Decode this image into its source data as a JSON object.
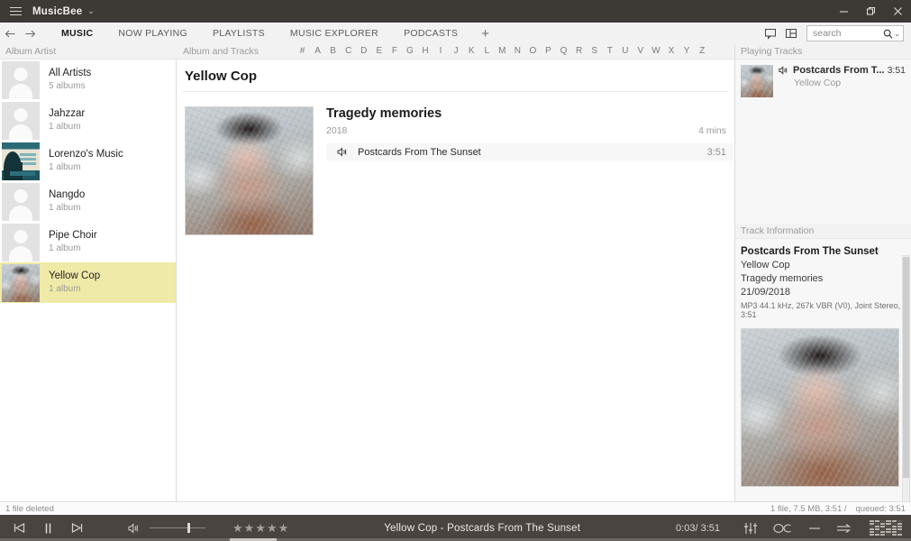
{
  "window": {
    "app_title": "MusicBee",
    "title_caret": "⌄",
    "minimize_label": "minimize",
    "maximize_label": "restore",
    "close_label": "close"
  },
  "toolbar": {
    "back_label": "back",
    "forward_label": "forward",
    "tabs": [
      {
        "label": "MUSIC",
        "active": true
      },
      {
        "label": "NOW PLAYING",
        "active": false
      },
      {
        "label": "PLAYLISTS",
        "active": false
      },
      {
        "label": "MUSIC EXPLORER",
        "active": false
      },
      {
        "label": "PODCASTS",
        "active": false
      }
    ],
    "add_tab_label": "+",
    "search": {
      "placeholder": "search",
      "value": ""
    }
  },
  "column_headers": {
    "left": "Album Artist",
    "middle": "Album and Tracks",
    "right": "Playing Tracks",
    "alphabet": [
      "#",
      "A",
      "B",
      "C",
      "D",
      "E",
      "F",
      "G",
      "H",
      "I",
      "J",
      "K",
      "L",
      "M",
      "N",
      "O",
      "P",
      "Q",
      "R",
      "S",
      "T",
      "U",
      "V",
      "W",
      "X",
      "Y",
      "Z"
    ]
  },
  "sidebar": {
    "items": [
      {
        "name": "All Artists",
        "sub": "5 albums",
        "selected": false,
        "art": "person"
      },
      {
        "name": "Jahzzar",
        "sub": "1 album",
        "selected": false,
        "art": "person"
      },
      {
        "name": "Lorenzo's Music",
        "sub": "1 album",
        "selected": false,
        "art": "lorenzo"
      },
      {
        "name": "Nangdo",
        "sub": "1 album",
        "selected": false,
        "art": "person"
      },
      {
        "name": "Pipe Choir",
        "sub": "1 album",
        "selected": false,
        "art": "person"
      },
      {
        "name": "Yellow Cop",
        "sub": "1 album",
        "selected": true,
        "art": "photo"
      }
    ]
  },
  "main": {
    "page_title": "Yellow Cop",
    "album": {
      "name": "Tragedy memories",
      "year": "2018",
      "length": "4 mins",
      "tracks": [
        {
          "playing_icon": "speaker-icon",
          "title": "Postcards From The Sunset",
          "duration": "3:51"
        }
      ]
    }
  },
  "right_panel": {
    "playing_tracks_header": "Playing Tracks",
    "playing": [
      {
        "title": "Postcards From T...",
        "artist": "Yellow Cop",
        "duration": "3:51"
      }
    ],
    "track_info_header": "Track Information",
    "track_info": {
      "title": "Postcards From The Sunset",
      "artist": "Yellow Cop",
      "album": "Tragedy memories",
      "date": "21/09/2018",
      "codec": "MP3 44.1 kHz, 267k VBR (V0), Joint Stereo, 3:51"
    }
  },
  "status_bar": {
    "left": "1 file deleted",
    "right": "1 file, 7.5 MB, 3:51 /",
    "queued": "queued: 3:51"
  },
  "player": {
    "previous_label": "previous",
    "play_pause_label": "pause",
    "next_label": "next",
    "volume_label": "volume",
    "rating_stars": "★★★★★",
    "now_playing": "Yellow Cop - Postcards From The Sunset",
    "elapsed": "0:03/",
    "total": "3:51",
    "equalizer_label": "equalizer",
    "lastfm_label": "last.fm scrobble",
    "shuffle_label": "shuffle",
    "repeat_label": "repeat",
    "visualizer_label": "visualizer"
  },
  "colors": {
    "titlebar": "#3d3935",
    "player": "#4a4440",
    "selection": "#f0eaa8",
    "toolbar": "#f2f2f2",
    "panel": "#f7f7f7"
  }
}
